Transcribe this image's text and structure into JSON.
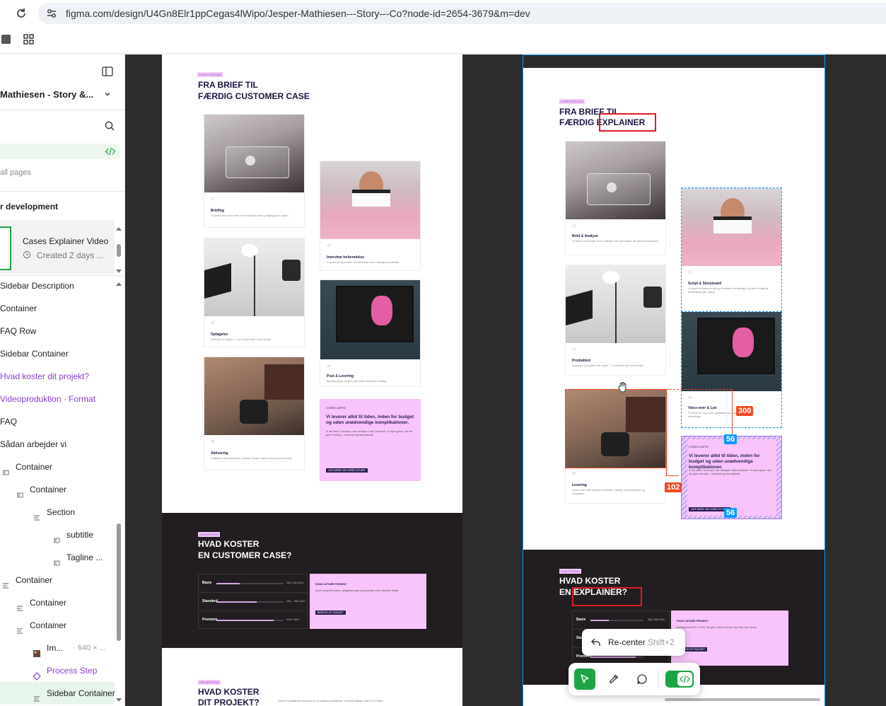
{
  "browser": {
    "url": "figma.com/design/U4Gn8Elr1ppCegas4lWipo/Jesper-Mathiesen---Story---Co?node-id=2654-3679&m=dev"
  },
  "sidebar": {
    "file_title": "Mathiesen - Story &...",
    "all_pages": "all pages",
    "section_title": "r development",
    "selected_item": {
      "title": "Cases Explainer Video",
      "meta": "Created 2 days ..."
    },
    "layers": [
      {
        "label": "Sidebar Description",
        "color": "#222222"
      },
      {
        "label": "Container",
        "color": "#222222"
      },
      {
        "label": "FAQ Row",
        "color": "#222222"
      },
      {
        "label": "Sidebar Container",
        "color": "#222222"
      },
      {
        "label": "Hvad koster dit projekt?",
        "color": "#8a3ed0"
      },
      {
        "label": "Videoproduktion · Format",
        "color": "#8a3ed0"
      },
      {
        "label": "FAQ",
        "color": "#222222"
      },
      {
        "label": "Sådan arbejder vi",
        "color": "#222222"
      },
      {
        "label": "Container",
        "color": "#222222"
      },
      {
        "label": "Container",
        "color": "#222222"
      },
      {
        "label": "Section",
        "color": "#222222"
      },
      {
        "label": "subtitle",
        "color": "#222222"
      },
      {
        "label": "Tagline ...",
        "color": "#222222"
      },
      {
        "label": "Container",
        "color": "#222222"
      },
      {
        "label": "Container",
        "color": "#222222"
      },
      {
        "label": "Container",
        "color": "#222222"
      },
      {
        "label": "Im...",
        "meta": "· 640 × ...",
        "color": "#222222"
      },
      {
        "label": "Process Step",
        "color": "#8a3ed0"
      },
      {
        "label": "Sidebar Container",
        "color": "#222222"
      }
    ]
  },
  "left_frame": {
    "tag": "VORES PROCES",
    "title_line1": "FRA BRIEF TIL",
    "title_line2": "FÆRDIG CUSTOMER CASE",
    "steps": [
      {
        "num": "01",
        "title": "Briefing",
        "desc": "Vi starter med et kort brief, hvor vi afklarer mål og målgruppe for casen."
      },
      {
        "num": "02",
        "title": "Interview forberedelse",
        "desc": "Vi guider jer og kunden, så interviewet bliver naturligt og autentisk."
      },
      {
        "num": "03",
        "title": "Optagelse",
        "desc": "Interview on location — hos kunden eller i vores studie."
      },
      {
        "num": "04",
        "title": "Post & Levering",
        "desc": "Klipning, grafik og farver gør casen skarp klar til deling."
      },
      {
        "num": "05",
        "title": "Aktivering",
        "desc": "Vi hjælper med distribution, hvordan I bruger casen bedst på jeres kanaler."
      }
    ],
    "promise_tag": "VORES LØFTE",
    "promise_title": "Vi leverer altid til tiden, inden for budget og uden unødvendige komplikationer.",
    "promise_desc": "Vi har base i Danmark, men arbejder i hele Danmark. Vi rejser gerne, når det giver mening — nationalt og internationalt.",
    "promise_cta": "LÆS MERE OM VORES STUDIE",
    "pricing_tag": "INVESTERING",
    "pricing_title_line1": "HVAD KOSTER",
    "pricing_title_line2": "EN CUSTOMER CASE?",
    "pricing_rows": [
      {
        "label": "Basis",
        "value": "15k–24k DKK",
        "level": 0.35
      },
      {
        "label": "Standard",
        "value": "24k – 40k DKK",
        "level": 0.6
      },
      {
        "label": "Premium",
        "value": "40k+ DKK",
        "level": 0.85
      }
    ],
    "pricing_box_title": "HVAD AFGØR PRISEN?",
    "pricing_box_desc": "Antal kundeinterviews, optagelsesdage og omfanget af de samlede forløb.",
    "pricing_box_cta": "BEREGN DIT BUDGET",
    "next_tag": "PROJEKTPRIS",
    "next_title_line1": "HVAD KOSTER",
    "next_title_line2": "DIT PROJEKT?",
    "next_desc": "Denne 5 fortløbende prosa her bl. et realistisk prisestimat. Vi sender tilbage inden for 24 timer."
  },
  "right_frame": {
    "tag": "VORES PROCES",
    "title_line1": "FRA BRIEF TIL",
    "title_line2": "FÆRDIG EXPLAINER",
    "steps": [
      {
        "num": "01",
        "title": "Brief & Analyse",
        "desc": "Vi starter med et brief, hvor vi afklarer mål og budskab, der skal kommunikeres."
      },
      {
        "num": "02",
        "title": "Script & Storyboard",
        "desc": "Vi skriver et præcist script og visualiserer fortællingen, så alle er enige før produktionen går i gang."
      },
      {
        "num": "03",
        "title": "Produktion",
        "desc": "Animation, live-action eller hybrid — vi realiserer det i fuld format."
      },
      {
        "num": "04",
        "title": "Voice-over & Lyd",
        "desc": "Professionel voice-over, lydeffekter og musik løfter fortællingen."
      },
      {
        "num": "05",
        "title": "Levering",
        "desc": "Lyd til + klar i alle formater til website, LinkedIn, præsentationer og kampagner."
      }
    ],
    "promise_tag": "VORES LØFTE",
    "promise_title": "Vi leverer altid til tiden, inden for budget og uden unødvendige komplikationer.",
    "promise_desc": "Vi har base i Danmark, men arbejder i hele Danmark. Vi rejser gerne, når det giver mening — nationalt og internationalt.",
    "promise_cta": "LÆS MERE OM VORES STUDIE",
    "pricing_tag": "INVESTERING",
    "pricing_title_line1": "HVAD KOSTER",
    "pricing_title_line2": "EN EXPLAINER?",
    "pricing_rows": [
      {
        "label": "Basis",
        "value": "30k–60k DKK",
        "level": 0.35
      },
      {
        "label": "Standard",
        "value": "",
        "level": 0.6
      },
      {
        "label": "Premium",
        "value": "",
        "level": 0.85
      }
    ],
    "pricing_box_title": "HVAD AFGØR PRISEN?",
    "pricing_box_desc": "Animationsstil (2D vs 3D), længde, antal versioner og voice-over sprog.",
    "pricing_box_cta": "BEREGN DIT BUDGET"
  },
  "measurements": {
    "m300": "300",
    "m102": "102",
    "m56_top": "56",
    "m56_bottom": "56"
  },
  "recenter": {
    "label": "Re-center",
    "shortcut": "Shift+2"
  }
}
